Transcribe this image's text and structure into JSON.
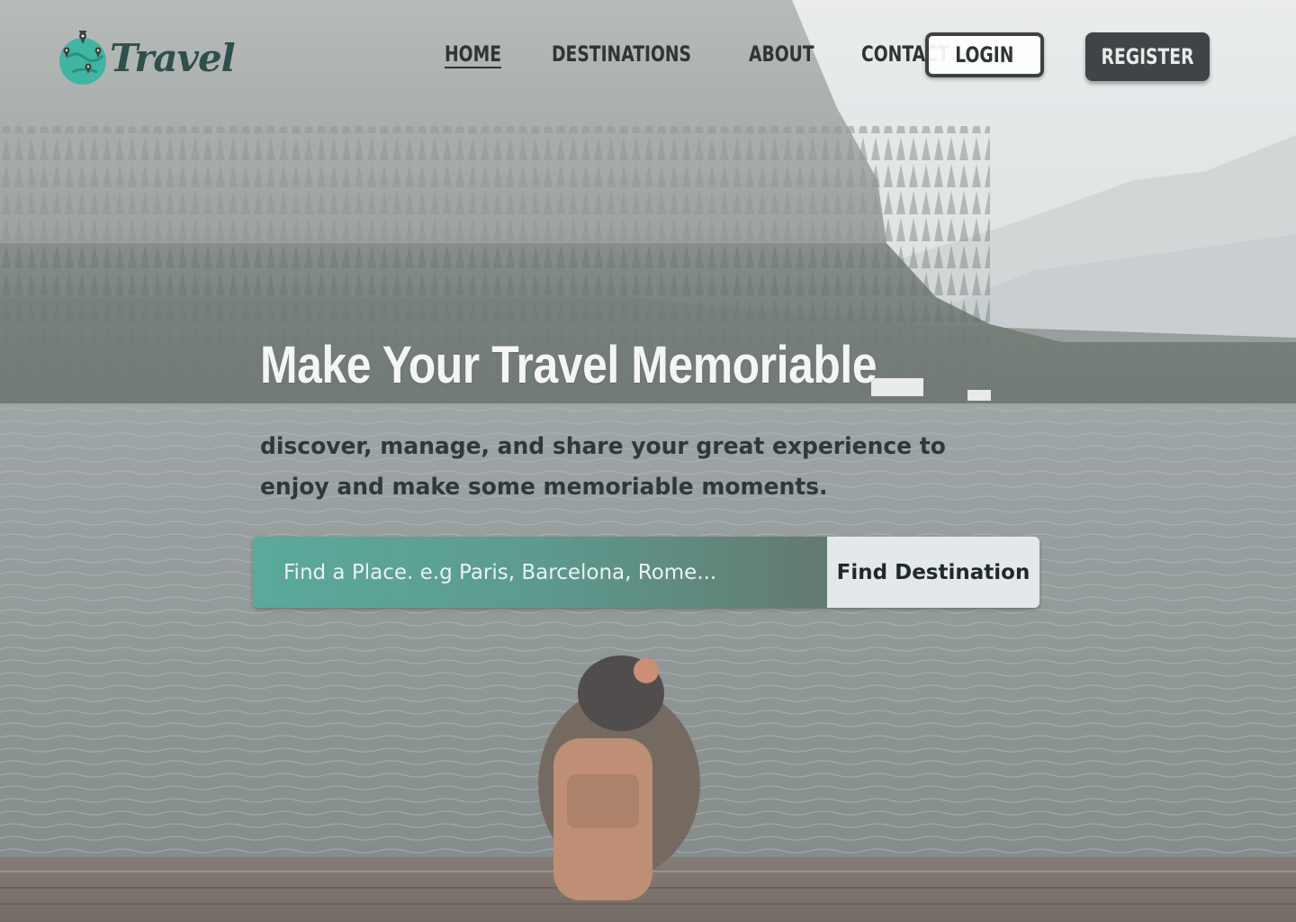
{
  "brand": {
    "name": "Travel",
    "accent": "#3fb5a2"
  },
  "nav": {
    "items": [
      {
        "label": "HOME",
        "active": true
      },
      {
        "label": "DESTINATIONS",
        "active": false
      },
      {
        "label": "ABOUT",
        "active": false
      },
      {
        "label": "CONTACT",
        "active": false
      }
    ],
    "login_label": "LOGIN",
    "register_label": "REGISTER"
  },
  "hero": {
    "headline": "Make Your Travel Memoriable",
    "subtext": "discover, manage, and share your great experience to enjoy and make some memoriable moments."
  },
  "search": {
    "placeholder": "Find a Place. e.g Paris, Barcelona, Rome...",
    "value": "",
    "button_label": "Find Destination"
  },
  "colors": {
    "dark": "#3f4446",
    "search_gradient_start": "#5aaa9b",
    "search_gradient_end": "#637a70"
  }
}
